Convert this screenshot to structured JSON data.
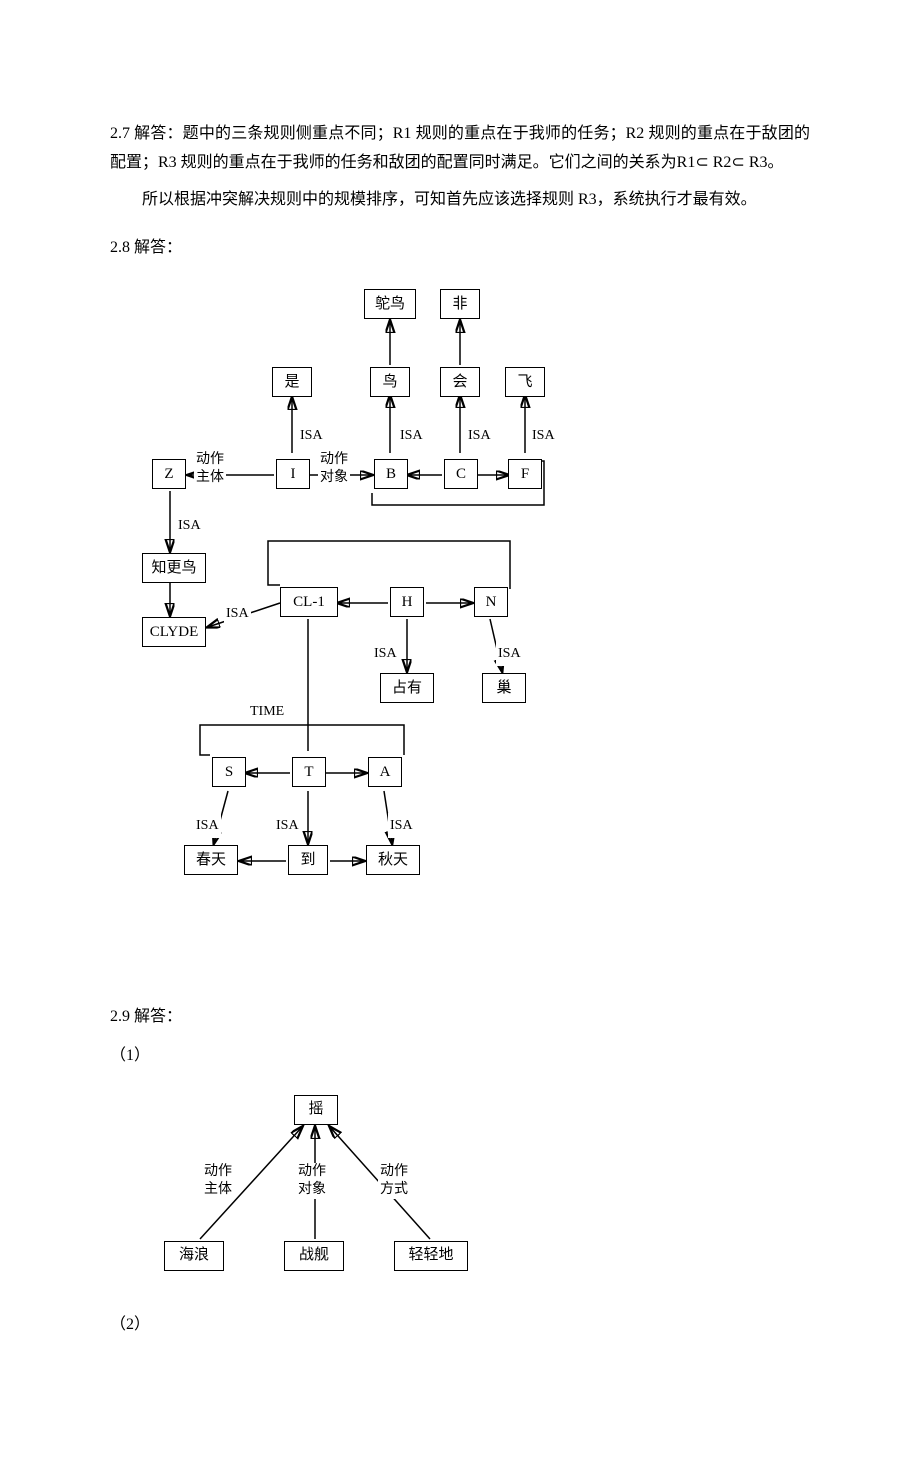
{
  "section27": {
    "text": "2.7 解答：题中的三条规则侧重点不同；R1 规则的重点在于我师的任务；R2 规则的重点在于敌团的配置；R3 规则的重点在于我师的任务和敌团的配置同时满足。它们之间的关系为R1⊂ R2⊂ R3。",
    "text2": "所以根据冲突解决规则中的规模排序，可知首先应该选择规则 R3，系统执行才最有效。"
  },
  "section28": {
    "label": "2.8 解答：",
    "nodes": {
      "tuoniao": "鸵鸟",
      "fei_neg": "非",
      "shi": "是",
      "niao": "鸟",
      "hui": "会",
      "fei": "飞",
      "Z": "Z",
      "I": "I",
      "B": "B",
      "C": "C",
      "F": "F",
      "zhigengniao": "知更鸟",
      "CLYDE": "CLYDE",
      "CL1": "CL-1",
      "H": "H",
      "N": "N",
      "zhanyou": "占有",
      "chao": "巢",
      "S": "S",
      "T": "T",
      "A": "A",
      "chuntian": "春天",
      "dao": "到",
      "qiutian": "秋天"
    },
    "edges": {
      "dongzuo_zhuti": "动作\n主体",
      "dongzuo_duixiang": "动作\n对象",
      "ISA": "ISA",
      "TIME": "TIME"
    }
  },
  "section29": {
    "label": "2.9 解答：",
    "sub1": "（1）",
    "sub2": "（2）",
    "nodes": {
      "yao": "摇",
      "hailang": "海浪",
      "zhanjian": "战舰",
      "qingqing": "轻轻地"
    },
    "edges": {
      "dongzuo_zhuti": "动作\n主体",
      "dongzuo_duixiang": "动作\n对象",
      "dongzuo_fangshi": "动作\n方式"
    }
  }
}
